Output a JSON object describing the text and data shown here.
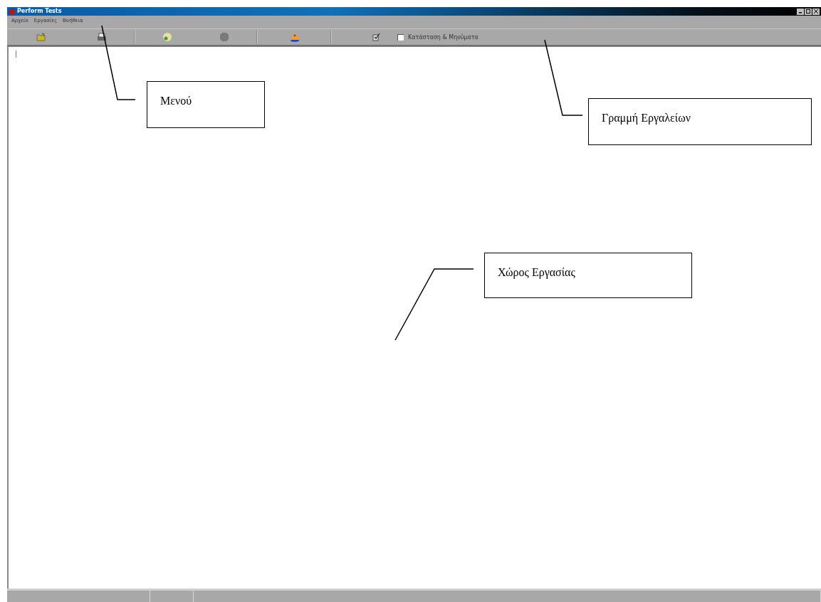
{
  "window": {
    "title": "Perform Tests"
  },
  "menu": [
    "Αρχείο",
    "Εργασίες",
    "Βοήθεια"
  ],
  "toolbar": {
    "status_checkbox": {
      "label": "Κατάσταση & Μηνύματα",
      "checked": false
    }
  },
  "annotations": [
    "Μενού",
    "Γραμμή Εργαλείων",
    "Χώρος Εργασίας"
  ]
}
